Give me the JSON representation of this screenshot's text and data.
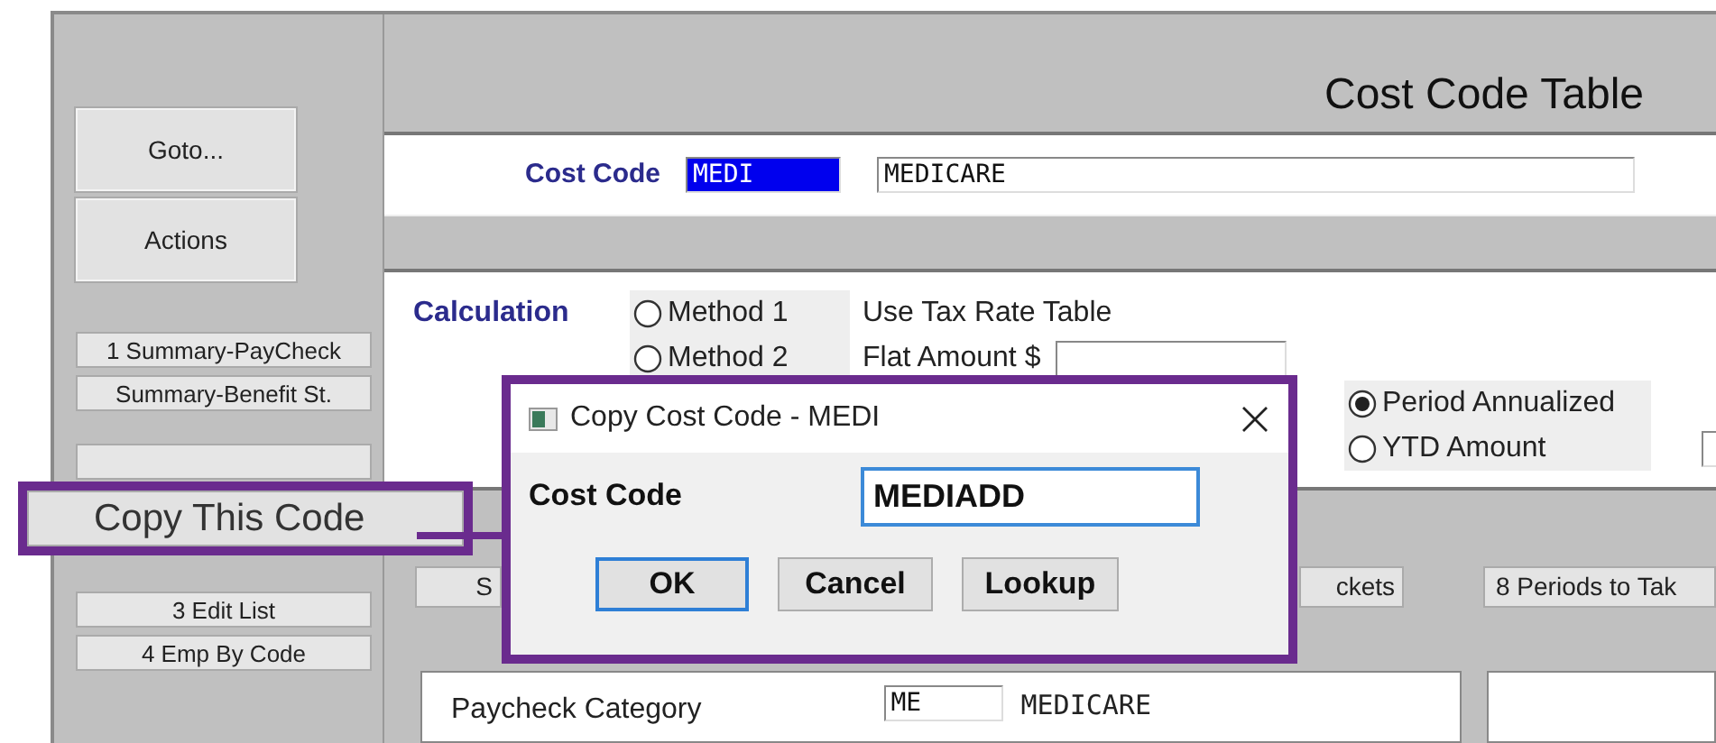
{
  "window": {
    "title": "Cost Code Table"
  },
  "sidebar": {
    "top_buttons": [
      "Goto...",
      "Actions"
    ],
    "report_buttons": [
      "1 Summary-PayCheck",
      "Summary-Benefit St."
    ],
    "bottom_buttons": [
      "3 Edit List",
      "4 Emp By Code"
    ]
  },
  "header": {
    "label": "Cost Code",
    "code": "MEDI",
    "code_selected": true,
    "description": "MEDICARE"
  },
  "calculation": {
    "label": "Calculation",
    "methods": [
      {
        "label": "Method 1",
        "selected": false
      },
      {
        "label": "Method 2",
        "selected": false
      }
    ],
    "method_texts": [
      "Use Tax Rate Table",
      "Flat Amount $"
    ],
    "periods": [
      {
        "label": "Period Annualized",
        "selected": true
      },
      {
        "label": "YTD Amount",
        "selected": false
      }
    ]
  },
  "band_buttons": [
    "S",
    "ckets",
    "8 Periods to Tak"
  ],
  "paycheck": {
    "label": "Paycheck Category",
    "code": "ME",
    "description": "MEDICARE"
  },
  "callout": {
    "label": "Copy This Code"
  },
  "dialog": {
    "title": "Copy Cost Code - MEDI",
    "field_label": "Cost Code",
    "value": "MEDIADD",
    "buttons": [
      {
        "label": "OK",
        "default": true
      },
      {
        "label": "Cancel",
        "default": false
      },
      {
        "label": "Lookup",
        "default": false
      }
    ]
  }
}
